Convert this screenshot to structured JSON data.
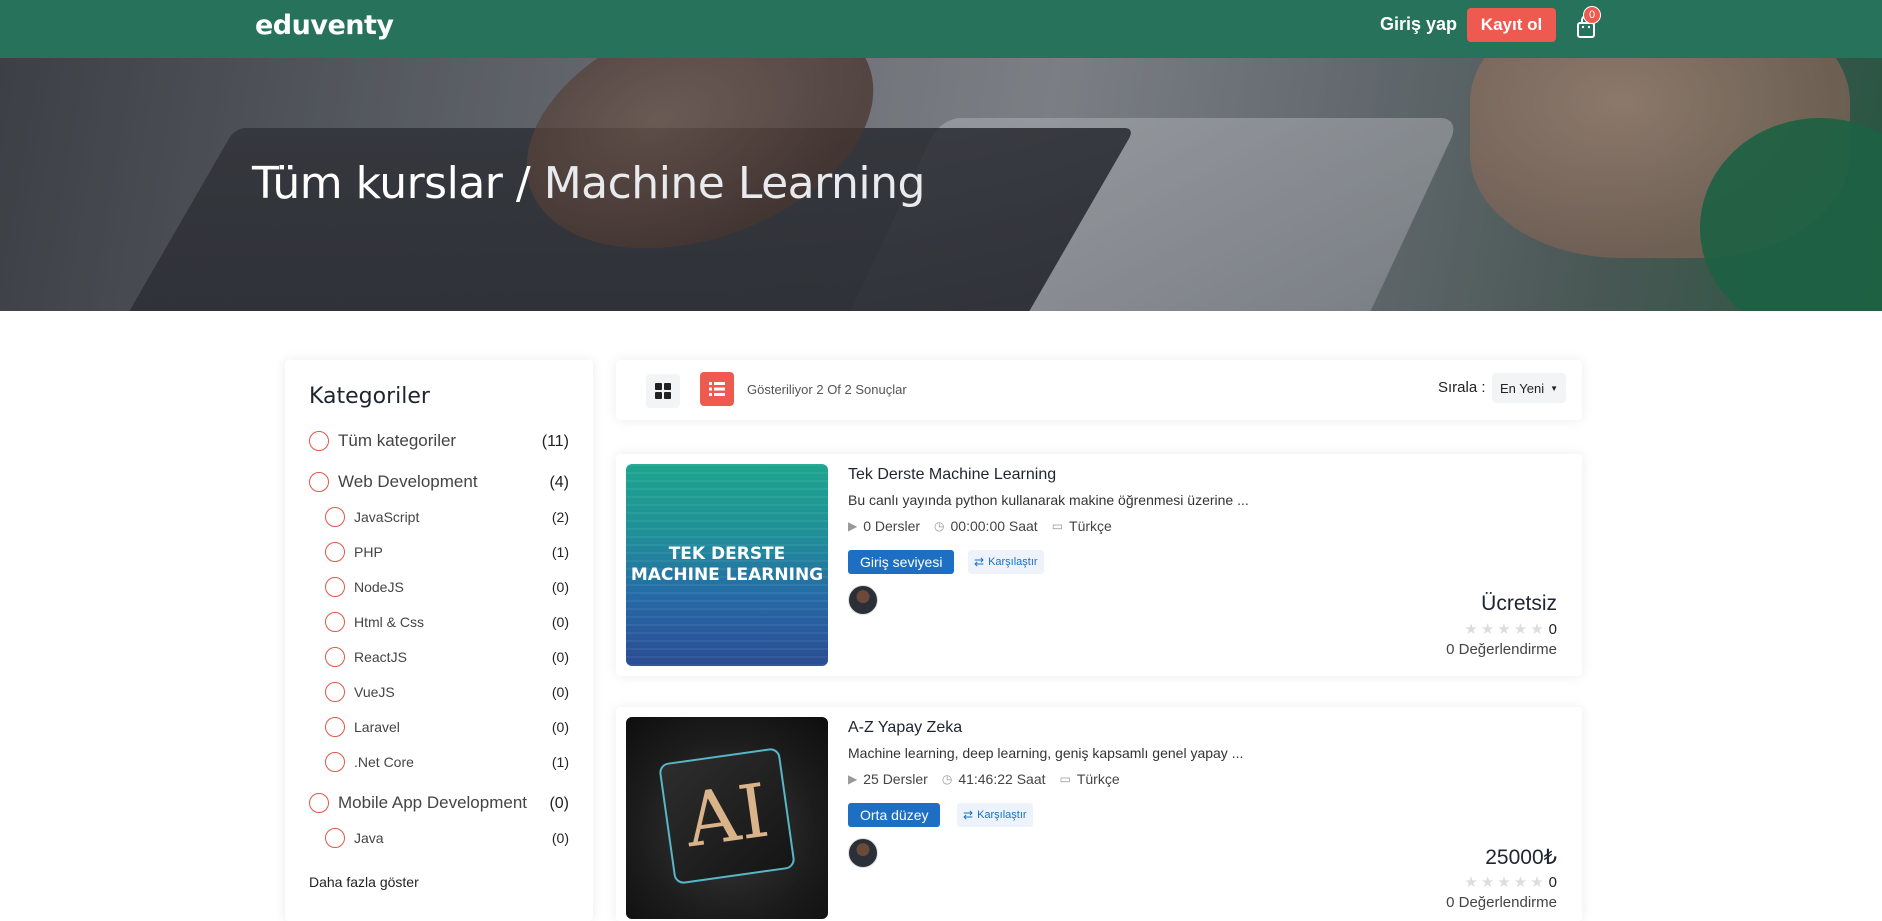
{
  "header": {
    "logo": "eduventy",
    "login": "Giriş yap",
    "signup": "Kayıt ol",
    "cart_count": "0"
  },
  "hero": {
    "title_main": "Tüm kurslar /",
    "title_sub": " Machine Learning"
  },
  "sidebar": {
    "title": "Kategoriler",
    "items": [
      {
        "label": "Tüm kategoriler",
        "count": "(11)",
        "level": "main"
      },
      {
        "label": "Web Development",
        "count": "(4)",
        "level": "main"
      },
      {
        "label": "JavaScript",
        "count": "(2)",
        "level": "sub"
      },
      {
        "label": "PHP",
        "count": "(1)",
        "level": "sub"
      },
      {
        "label": "NodeJS",
        "count": "(0)",
        "level": "sub"
      },
      {
        "label": "Html & Css",
        "count": "(0)",
        "level": "sub"
      },
      {
        "label": "ReactJS",
        "count": "(0)",
        "level": "sub"
      },
      {
        "label": "VueJS",
        "count": "(0)",
        "level": "sub"
      },
      {
        "label": "Laravel",
        "count": "(0)",
        "level": "sub"
      },
      {
        "label": ".Net Core",
        "count": "(1)",
        "level": "sub"
      },
      {
        "label": "Mobile App Development",
        "count": "(0)",
        "level": "main"
      },
      {
        "label": "Java",
        "count": "(0)",
        "level": "sub"
      }
    ],
    "more": "Daha fazla göster"
  },
  "toolbar": {
    "showing": "Gösteriliyor 2 Of 2 Sonuçlar",
    "sort_label": "Sırala :",
    "sort_value": "En Yeni"
  },
  "courses": [
    {
      "title": "Tek Derste Machine Learning",
      "desc": "Bu canlı yayında python kullanarak makine öğrenmesi üzerine ...",
      "lessons": "0 Dersler",
      "duration": "00:00:00 Saat",
      "language": "Türkçe",
      "level": "Giriş seviyesi",
      "compare": "Karşılaştır",
      "price": "Ücretsiz",
      "rating": "0",
      "rating_count": "0 Değerlendirme",
      "thumb_text_1": "TEK DERSTE",
      "thumb_text_2": "MACHINE LEARNING"
    },
    {
      "title": "A-Z Yapay Zeka",
      "desc": "Machine learning, deep learning, geniş kapsamlı genel yapay ...",
      "lessons": "25 Dersler",
      "duration": "41:46:22 Saat",
      "language": "Türkçe",
      "level": "Orta düzey",
      "compare": "Karşılaştır",
      "price": "25000₺",
      "rating": "0",
      "rating_count": "0 Değerlendirme",
      "thumb_text_1": "AI"
    }
  ],
  "colors": {
    "header_bg": "#27725a",
    "accent_red": "#ef5a50",
    "level_blue": "#1c6fc2"
  }
}
